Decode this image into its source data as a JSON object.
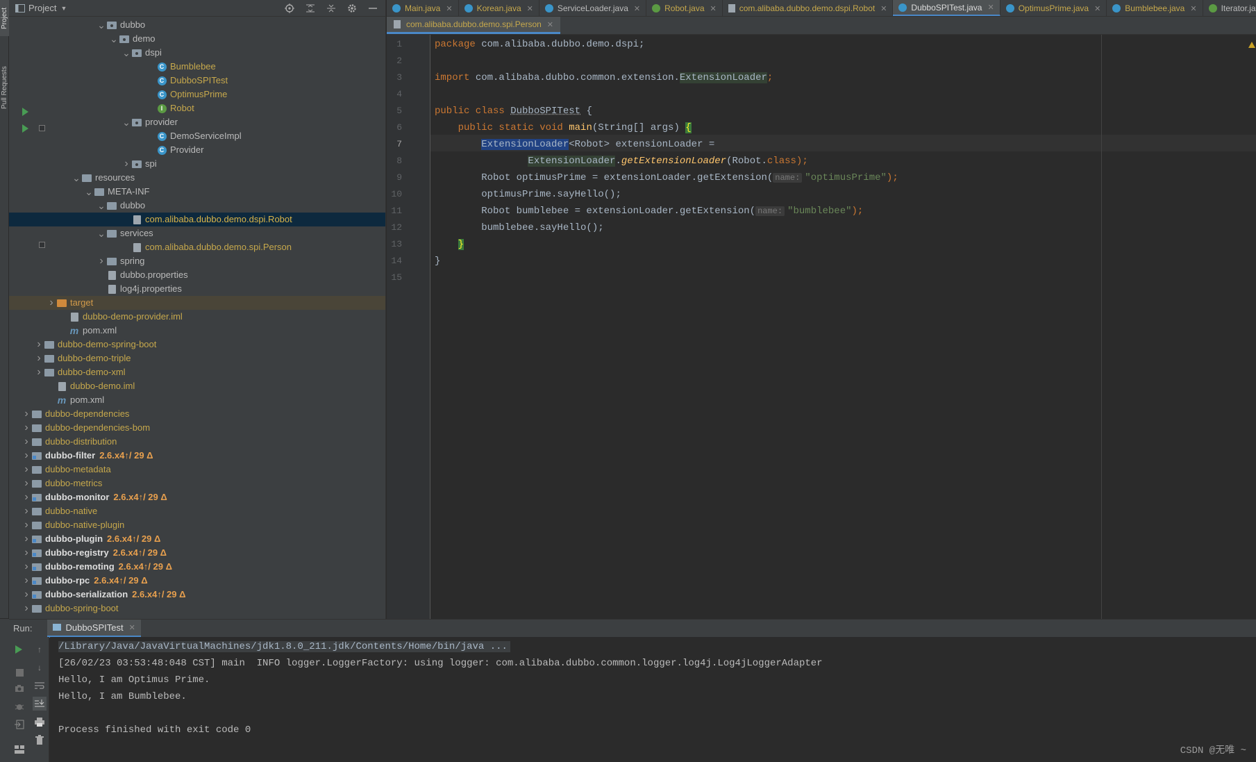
{
  "project_panel": {
    "title": "Project",
    "tree": [
      {
        "indent": 7,
        "arrow": "down",
        "icon": "folder-package",
        "label": "dubbo",
        "style": "white"
      },
      {
        "indent": 8,
        "arrow": "down",
        "icon": "folder-package",
        "label": "demo",
        "style": "white"
      },
      {
        "indent": 9,
        "arrow": "down",
        "icon": "folder-package",
        "label": "dspi",
        "style": "white"
      },
      {
        "indent": 11,
        "arrow": "",
        "icon": "class-icon",
        "label": "Bumblebee",
        "style": "yellow"
      },
      {
        "indent": 11,
        "arrow": "",
        "icon": "class-icon",
        "label": "DubboSPITest",
        "style": "yellow"
      },
      {
        "indent": 11,
        "arrow": "",
        "icon": "class-icon",
        "label": "OptimusPrime",
        "style": "yellow"
      },
      {
        "indent": 11,
        "arrow": "",
        "icon": "interface-icon",
        "label": "Robot",
        "style": "yellow"
      },
      {
        "indent": 9,
        "arrow": "down",
        "icon": "folder-package",
        "label": "provider",
        "style": "white"
      },
      {
        "indent": 11,
        "arrow": "",
        "icon": "class-icon",
        "label": "DemoServiceImpl",
        "style": "white"
      },
      {
        "indent": 11,
        "arrow": "",
        "icon": "class-icon",
        "label": "Provider",
        "style": "white"
      },
      {
        "indent": 9,
        "arrow": "right",
        "icon": "folder-package",
        "label": "spi",
        "style": "white"
      },
      {
        "indent": 5,
        "arrow": "down",
        "icon": "folder-resources",
        "label": "resources",
        "style": "white"
      },
      {
        "indent": 6,
        "arrow": "down",
        "icon": "folder",
        "label": "META-INF",
        "style": "white"
      },
      {
        "indent": 7,
        "arrow": "down",
        "icon": "folder",
        "label": "dubbo",
        "style": "white"
      },
      {
        "indent": 9,
        "arrow": "",
        "icon": "file-icon",
        "label": "com.alibaba.dubbo.demo.dspi.Robot",
        "style": "sel",
        "selected": true
      },
      {
        "indent": 7,
        "arrow": "down",
        "icon": "folder",
        "label": "services",
        "style": "white"
      },
      {
        "indent": 9,
        "arrow": "",
        "icon": "file-icon",
        "label": "com.alibaba.dubbo.demo.spi.Person",
        "style": "yellow"
      },
      {
        "indent": 7,
        "arrow": "right",
        "icon": "folder",
        "label": "spring",
        "style": "white"
      },
      {
        "indent": 7,
        "arrow": "",
        "icon": "properties-icon",
        "label": "dubbo.properties",
        "style": "white"
      },
      {
        "indent": 7,
        "arrow": "",
        "icon": "properties-icon",
        "label": "log4j.properties",
        "style": "white"
      },
      {
        "indent": 3,
        "arrow": "right",
        "icon": "folder-orange",
        "label": "target",
        "style": "orange",
        "hl": true
      },
      {
        "indent": 4,
        "arrow": "",
        "icon": "iml-icon",
        "label": "dubbo-demo-provider.iml",
        "style": "yellow"
      },
      {
        "indent": 4,
        "arrow": "",
        "icon": "maven-icon",
        "label": "pom.xml",
        "style": "white"
      },
      {
        "indent": 2,
        "arrow": "right",
        "icon": "folder",
        "label": "dubbo-demo-spring-boot",
        "style": "yellow"
      },
      {
        "indent": 2,
        "arrow": "right",
        "icon": "folder",
        "label": "dubbo-demo-triple",
        "style": "yellow"
      },
      {
        "indent": 2,
        "arrow": "right",
        "icon": "folder",
        "label": "dubbo-demo-xml",
        "style": "yellow"
      },
      {
        "indent": 3,
        "arrow": "",
        "icon": "iml-icon",
        "label": "dubbo-demo.iml",
        "style": "yellow"
      },
      {
        "indent": 3,
        "arrow": "",
        "icon": "maven-icon",
        "label": "pom.xml",
        "style": "white"
      },
      {
        "indent": 1,
        "arrow": "right",
        "icon": "folder",
        "label": "dubbo-dependencies",
        "style": "yellow"
      },
      {
        "indent": 1,
        "arrow": "right",
        "icon": "folder",
        "label": "dubbo-dependencies-bom",
        "style": "yellow"
      },
      {
        "indent": 1,
        "arrow": "right",
        "icon": "folder",
        "label": "dubbo-distribution",
        "style": "yellow"
      },
      {
        "indent": 1,
        "arrow": "right",
        "icon": "folder-module",
        "label": "dubbo-filter",
        "style": "bold",
        "version": "2.6.x4↑/ 29 Δ"
      },
      {
        "indent": 1,
        "arrow": "right",
        "icon": "folder",
        "label": "dubbo-metadata",
        "style": "yellow"
      },
      {
        "indent": 1,
        "arrow": "right",
        "icon": "folder",
        "label": "dubbo-metrics",
        "style": "yellow"
      },
      {
        "indent": 1,
        "arrow": "right",
        "icon": "folder-module",
        "label": "dubbo-monitor",
        "style": "bold",
        "version": "2.6.x4↑/ 29 Δ"
      },
      {
        "indent": 1,
        "arrow": "right",
        "icon": "folder",
        "label": "dubbo-native",
        "style": "yellow"
      },
      {
        "indent": 1,
        "arrow": "right",
        "icon": "folder",
        "label": "dubbo-native-plugin",
        "style": "yellow"
      },
      {
        "indent": 1,
        "arrow": "right",
        "icon": "folder-module",
        "label": "dubbo-plugin",
        "style": "bold",
        "version": "2.6.x4↑/ 29 Δ"
      },
      {
        "indent": 1,
        "arrow": "right",
        "icon": "folder-module",
        "label": "dubbo-registry",
        "style": "bold",
        "version": "2.6.x4↑/ 29 Δ"
      },
      {
        "indent": 1,
        "arrow": "right",
        "icon": "folder-module",
        "label": "dubbo-remoting",
        "style": "bold",
        "version": "2.6.x4↑/ 29 Δ"
      },
      {
        "indent": 1,
        "arrow": "right",
        "icon": "folder-module",
        "label": "dubbo-rpc",
        "style": "bold",
        "version": "2.6.x4↑/ 29 Δ"
      },
      {
        "indent": 1,
        "arrow": "right",
        "icon": "folder-module",
        "label": "dubbo-serialization",
        "style": "bold",
        "version": "2.6.x4↑/ 29 Δ"
      },
      {
        "indent": 1,
        "arrow": "right",
        "icon": "folder",
        "label": "dubbo-spring-boot",
        "style": "yellow"
      }
    ]
  },
  "left_strip": {
    "project_tab": "Project",
    "pull_requests_tab": "Pull Requests"
  },
  "tabs": [
    {
      "label": "Main.java",
      "icon": "class",
      "style": "yellow"
    },
    {
      "label": "Korean.java",
      "icon": "class",
      "style": "yellow"
    },
    {
      "label": "ServiceLoader.java",
      "icon": "class-lib",
      "style": "white"
    },
    {
      "label": "Robot.java",
      "icon": "interface",
      "style": "yellow"
    },
    {
      "label": "com.alibaba.dubbo.demo.dspi.Robot",
      "icon": "file",
      "style": "yellow"
    },
    {
      "label": "DubboSPITest.java",
      "icon": "class",
      "style": "yellow",
      "active": true
    },
    {
      "label": "OptimusPrime.java",
      "icon": "class",
      "style": "yellow"
    },
    {
      "label": "Bumblebee.java",
      "icon": "class",
      "style": "yellow"
    },
    {
      "label": "Iterator.java",
      "icon": "interface",
      "style": "white"
    }
  ],
  "second_tab": {
    "label": "com.alibaba.dubbo.demo.spi.Person"
  },
  "editor": {
    "line_numbers": [
      "1",
      "2",
      "3",
      "4",
      "5",
      "6",
      "7",
      "8",
      "9",
      "10",
      "11",
      "12",
      "13",
      "14",
      "15"
    ],
    "current_line": 7,
    "code": {
      "l1_kw": "package",
      "l1_rest": " com.alibaba.dubbo.demo.dspi;",
      "l3_kw": "import",
      "l3_pkg": " com.alibaba.dubbo.common.extension.",
      "l3_cls": "ExtensionLoader",
      "l3_end": ";",
      "l5_kw": "public class ",
      "l5_cls": "DubboSPITest",
      "l5_end": " {",
      "l6_kw": "    public static void ",
      "l6_fn": "main",
      "l6_args": "(String[] args) ",
      "l6_brace": "{",
      "l7_indent": "        ",
      "l7_sel": "ExtensionLoader",
      "l7_rest": "<Robot> extensionLoader =",
      "l8_indent": "                ",
      "l8_cls": "ExtensionLoader",
      "l8_dot": ".",
      "l8_fn": "getExtensionLoader",
      "l8_args": "(Robot.",
      "l8_kw": "class",
      "l8_end": ");",
      "l9_a": "        Robot optimusPrime = extensionLoader.getExtension(",
      "l9_hint": "name:",
      "l9_str": "\"optimusPrime\"",
      "l9_end": ");",
      "l10": "        optimusPrime.sayHello();",
      "l11_a": "        Robot bumblebee = extensionLoader.getExtension(",
      "l11_hint": "name:",
      "l11_str": "\"bumblebee\"",
      "l11_end": ");",
      "l12": "        bumblebee.sayHello();",
      "l13_indent": "    ",
      "l13_brace": "}",
      "l14": "}"
    }
  },
  "run_panel": {
    "label": "Run:",
    "tab": "DubboSPITest",
    "lines": [
      "/Library/Java/JavaVirtualMachines/jdk1.8.0_211.jdk/Contents/Home/bin/java ...",
      "[26/02/23 03:53:48:048 CST] main  INFO logger.LoggerFactory: using logger: com.alibaba.dubbo.common.logger.log4j.Log4jLoggerAdapter",
      "Hello, I am Optimus Prime.",
      "Hello, I am Bumblebee.",
      "",
      "Process finished with exit code 0"
    ]
  },
  "watermark": "CSDN @无唯 ~"
}
